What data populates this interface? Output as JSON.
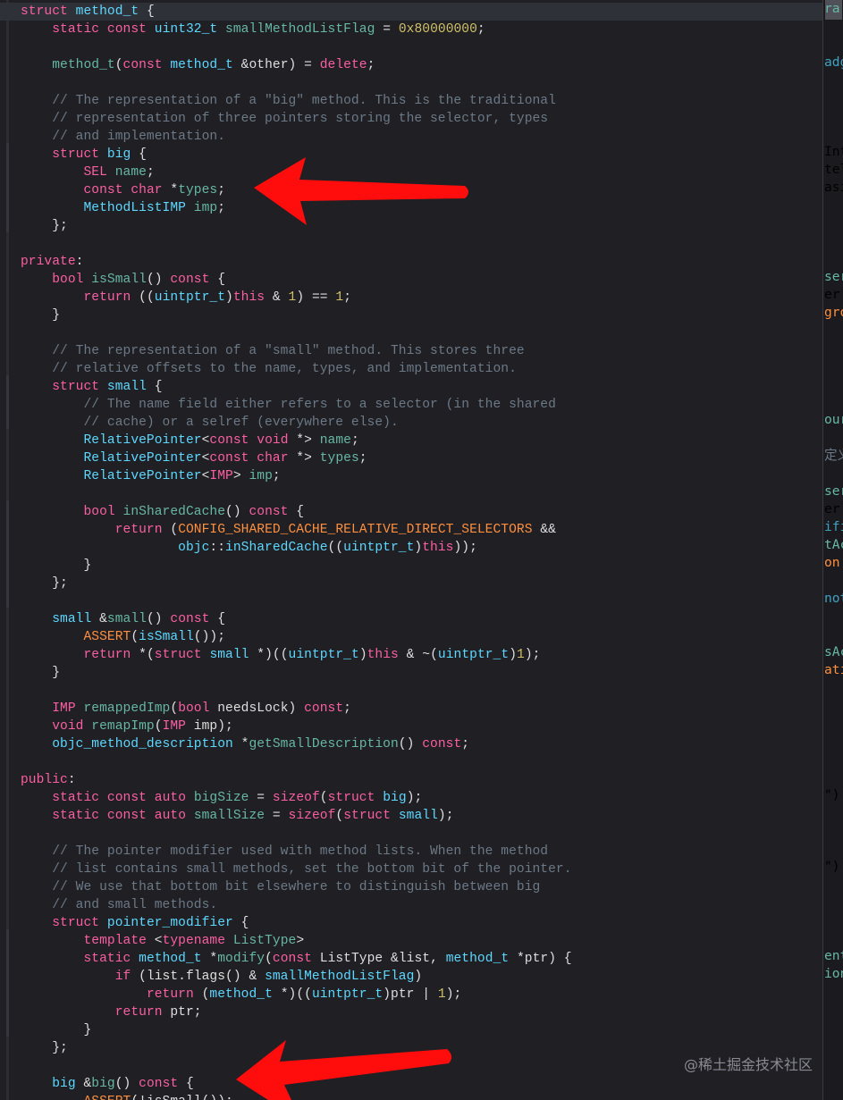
{
  "editor": {
    "lines": [
      [
        {
          "t": "struct",
          "c": "kw"
        },
        {
          "t": " "
        },
        {
          "t": "method_t",
          "c": "ty"
        },
        {
          "t": " {"
        }
      ],
      [
        {
          "t": "    "
        },
        {
          "t": "static",
          "c": "kw"
        },
        {
          "t": " "
        },
        {
          "t": "const",
          "c": "kw"
        },
        {
          "t": " "
        },
        {
          "t": "uint32_t",
          "c": "ty"
        },
        {
          "t": " "
        },
        {
          "t": "smallMethodListFlag",
          "c": "pj"
        },
        {
          "t": " = "
        },
        {
          "t": "0x80000000",
          "c": "nm"
        },
        {
          "t": ";"
        }
      ],
      [],
      [
        {
          "t": "    "
        },
        {
          "t": "method_t",
          "c": "pj"
        },
        {
          "t": "("
        },
        {
          "t": "const",
          "c": "kw"
        },
        {
          "t": " "
        },
        {
          "t": "method_t",
          "c": "ty"
        },
        {
          "t": " &other) = "
        },
        {
          "t": "delete",
          "c": "kw"
        },
        {
          "t": ";"
        }
      ],
      [],
      [
        {
          "t": "    // The representation of a \"big\" method. This is the traditional",
          "c": "cm"
        }
      ],
      [
        {
          "t": "    // representation of three pointers storing the selector, types",
          "c": "cm"
        }
      ],
      [
        {
          "t": "    // and implementation.",
          "c": "cm"
        }
      ],
      [
        {
          "t": "    "
        },
        {
          "t": "struct",
          "c": "kw"
        },
        {
          "t": " "
        },
        {
          "t": "big",
          "c": "ty"
        },
        {
          "t": " {"
        }
      ],
      [
        {
          "t": "        "
        },
        {
          "t": "SEL",
          "c": "kw"
        },
        {
          "t": " "
        },
        {
          "t": "name",
          "c": "pj"
        },
        {
          "t": ";"
        }
      ],
      [
        {
          "t": "        "
        },
        {
          "t": "const",
          "c": "kw"
        },
        {
          "t": " "
        },
        {
          "t": "char",
          "c": "kw"
        },
        {
          "t": " *"
        },
        {
          "t": "types",
          "c": "pj"
        },
        {
          "t": ";"
        }
      ],
      [
        {
          "t": "        "
        },
        {
          "t": "MethodListIMP",
          "c": "ty"
        },
        {
          "t": " "
        },
        {
          "t": "imp",
          "c": "pj"
        },
        {
          "t": ";"
        }
      ],
      [
        {
          "t": "    };"
        }
      ],
      [],
      [
        {
          "t": "private",
          "c": "kw"
        },
        {
          "t": ":"
        }
      ],
      [
        {
          "t": "    "
        },
        {
          "t": "bool",
          "c": "kw"
        },
        {
          "t": " "
        },
        {
          "t": "isSmall",
          "c": "pj"
        },
        {
          "t": "() "
        },
        {
          "t": "const",
          "c": "kw"
        },
        {
          "t": " {"
        }
      ],
      [
        {
          "t": "        "
        },
        {
          "t": "return",
          "c": "kw"
        },
        {
          "t": " (("
        },
        {
          "t": "uintptr_t",
          "c": "ty"
        },
        {
          "t": ")"
        },
        {
          "t": "this",
          "c": "kw"
        },
        {
          "t": " & "
        },
        {
          "t": "1",
          "c": "nm"
        },
        {
          "t": ") == "
        },
        {
          "t": "1",
          "c": "nm"
        },
        {
          "t": ";"
        }
      ],
      [
        {
          "t": "    }"
        }
      ],
      [],
      [
        {
          "t": "    // The representation of a \"small\" method. This stores three",
          "c": "cm"
        }
      ],
      [
        {
          "t": "    // relative offsets to the name, types, and implementation.",
          "c": "cm"
        }
      ],
      [
        {
          "t": "    "
        },
        {
          "t": "struct",
          "c": "kw"
        },
        {
          "t": " "
        },
        {
          "t": "small",
          "c": "ty"
        },
        {
          "t": " {"
        }
      ],
      [
        {
          "t": "        // The name field either refers to a selector (in the shared",
          "c": "cm"
        }
      ],
      [
        {
          "t": "        // cache) or a selref (everywhere else).",
          "c": "cm"
        }
      ],
      [
        {
          "t": "        "
        },
        {
          "t": "RelativePointer",
          "c": "ty"
        },
        {
          "t": "<"
        },
        {
          "t": "const",
          "c": "kw"
        },
        {
          "t": " "
        },
        {
          "t": "void",
          "c": "kw"
        },
        {
          "t": " *> "
        },
        {
          "t": "name",
          "c": "pj"
        },
        {
          "t": ";"
        }
      ],
      [
        {
          "t": "        "
        },
        {
          "t": "RelativePointer",
          "c": "ty"
        },
        {
          "t": "<"
        },
        {
          "t": "const",
          "c": "kw"
        },
        {
          "t": " "
        },
        {
          "t": "char",
          "c": "kw"
        },
        {
          "t": " *> "
        },
        {
          "t": "types",
          "c": "pj"
        },
        {
          "t": ";"
        }
      ],
      [
        {
          "t": "        "
        },
        {
          "t": "RelativePointer",
          "c": "ty"
        },
        {
          "t": "<"
        },
        {
          "t": "IMP",
          "c": "kw"
        },
        {
          "t": "> "
        },
        {
          "t": "imp",
          "c": "pj"
        },
        {
          "t": ";"
        }
      ],
      [],
      [
        {
          "t": "        "
        },
        {
          "t": "bool",
          "c": "kw"
        },
        {
          "t": " "
        },
        {
          "t": "inSharedCache",
          "c": "pj"
        },
        {
          "t": "() "
        },
        {
          "t": "const",
          "c": "kw"
        },
        {
          "t": " {"
        }
      ],
      [
        {
          "t": "            "
        },
        {
          "t": "return",
          "c": "kw"
        },
        {
          "t": " ("
        },
        {
          "t": "CONFIG_SHARED_CACHE_RELATIVE_DIRECT_SELECTORS",
          "c": "pp"
        },
        {
          "t": " &&"
        }
      ],
      [
        {
          "t": "                    "
        },
        {
          "t": "objc",
          "c": "ty"
        },
        {
          "t": "::"
        },
        {
          "t": "inSharedCache",
          "c": "ty"
        },
        {
          "t": "(("
        },
        {
          "t": "uintptr_t",
          "c": "ty"
        },
        {
          "t": ")"
        },
        {
          "t": "this",
          "c": "kw"
        },
        {
          "t": "));"
        }
      ],
      [
        {
          "t": "        }"
        }
      ],
      [
        {
          "t": "    };"
        }
      ],
      [],
      [
        {
          "t": "    "
        },
        {
          "t": "small",
          "c": "ty"
        },
        {
          "t": " &"
        },
        {
          "t": "small",
          "c": "pj"
        },
        {
          "t": "() "
        },
        {
          "t": "const",
          "c": "kw"
        },
        {
          "t": " {"
        }
      ],
      [
        {
          "t": "        "
        },
        {
          "t": "ASSERT",
          "c": "pp"
        },
        {
          "t": "("
        },
        {
          "t": "isSmall",
          "c": "ty"
        },
        {
          "t": "());"
        }
      ],
      [
        {
          "t": "        "
        },
        {
          "t": "return",
          "c": "kw"
        },
        {
          "t": " *("
        },
        {
          "t": "struct",
          "c": "kw"
        },
        {
          "t": " "
        },
        {
          "t": "small",
          "c": "ty"
        },
        {
          "t": " *)(("
        },
        {
          "t": "uintptr_t",
          "c": "ty"
        },
        {
          "t": ")"
        },
        {
          "t": "this",
          "c": "kw"
        },
        {
          "t": " & ~("
        },
        {
          "t": "uintptr_t",
          "c": "ty"
        },
        {
          "t": ")"
        },
        {
          "t": "1",
          "c": "nm"
        },
        {
          "t": ");"
        }
      ],
      [
        {
          "t": "    }"
        }
      ],
      [],
      [
        {
          "t": "    "
        },
        {
          "t": "IMP",
          "c": "kw"
        },
        {
          "t": " "
        },
        {
          "t": "remappedImp",
          "c": "pj"
        },
        {
          "t": "("
        },
        {
          "t": "bool",
          "c": "kw"
        },
        {
          "t": " needsLock) "
        },
        {
          "t": "const",
          "c": "kw"
        },
        {
          "t": ";"
        }
      ],
      [
        {
          "t": "    "
        },
        {
          "t": "void",
          "c": "kw"
        },
        {
          "t": " "
        },
        {
          "t": "remapImp",
          "c": "pj"
        },
        {
          "t": "("
        },
        {
          "t": "IMP",
          "c": "kw"
        },
        {
          "t": " imp);"
        }
      ],
      [
        {
          "t": "    "
        },
        {
          "t": "objc_method_description",
          "c": "ty"
        },
        {
          "t": " *"
        },
        {
          "t": "getSmallDescription",
          "c": "pj"
        },
        {
          "t": "() "
        },
        {
          "t": "const",
          "c": "kw"
        },
        {
          "t": ";"
        }
      ],
      [],
      [
        {
          "t": "public",
          "c": "kw"
        },
        {
          "t": ":"
        }
      ],
      [
        {
          "t": "    "
        },
        {
          "t": "static",
          "c": "kw"
        },
        {
          "t": " "
        },
        {
          "t": "const",
          "c": "kw"
        },
        {
          "t": " "
        },
        {
          "t": "auto",
          "c": "kw"
        },
        {
          "t": " "
        },
        {
          "t": "bigSize",
          "c": "pj"
        },
        {
          "t": " = "
        },
        {
          "t": "sizeof",
          "c": "kw"
        },
        {
          "t": "("
        },
        {
          "t": "struct",
          "c": "kw"
        },
        {
          "t": " "
        },
        {
          "t": "big",
          "c": "ty"
        },
        {
          "t": ");"
        }
      ],
      [
        {
          "t": "    "
        },
        {
          "t": "static",
          "c": "kw"
        },
        {
          "t": " "
        },
        {
          "t": "const",
          "c": "kw"
        },
        {
          "t": " "
        },
        {
          "t": "auto",
          "c": "kw"
        },
        {
          "t": " "
        },
        {
          "t": "smallSize",
          "c": "pj"
        },
        {
          "t": " = "
        },
        {
          "t": "sizeof",
          "c": "kw"
        },
        {
          "t": "("
        },
        {
          "t": "struct",
          "c": "kw"
        },
        {
          "t": " "
        },
        {
          "t": "small",
          "c": "ty"
        },
        {
          "t": ");"
        }
      ],
      [],
      [
        {
          "t": "    // The pointer modifier used with method lists. When the method",
          "c": "cm"
        }
      ],
      [
        {
          "t": "    // list contains small methods, set the bottom bit of the pointer.",
          "c": "cm"
        }
      ],
      [
        {
          "t": "    // We use that bottom bit elsewhere to distinguish between big",
          "c": "cm"
        }
      ],
      [
        {
          "t": "    // and small methods.",
          "c": "cm"
        }
      ],
      [
        {
          "t": "    "
        },
        {
          "t": "struct",
          "c": "kw"
        },
        {
          "t": " "
        },
        {
          "t": "pointer_modifier",
          "c": "ty"
        },
        {
          "t": " {"
        }
      ],
      [
        {
          "t": "        "
        },
        {
          "t": "template",
          "c": "kw"
        },
        {
          "t": " <"
        },
        {
          "t": "typename",
          "c": "kw"
        },
        {
          "t": " "
        },
        {
          "t": "ListType",
          "c": "pj"
        },
        {
          "t": ">"
        }
      ],
      [
        {
          "t": "        "
        },
        {
          "t": "static",
          "c": "kw"
        },
        {
          "t": " "
        },
        {
          "t": "method_t",
          "c": "ty"
        },
        {
          "t": " *"
        },
        {
          "t": "modify",
          "c": "pj"
        },
        {
          "t": "("
        },
        {
          "t": "const",
          "c": "kw"
        },
        {
          "t": " ListType &list, "
        },
        {
          "t": "method_t",
          "c": "ty"
        },
        {
          "t": " *ptr) {"
        }
      ],
      [
        {
          "t": "            "
        },
        {
          "t": "if",
          "c": "kw"
        },
        {
          "t": " (list.flags() & "
        },
        {
          "t": "smallMethodListFlag",
          "c": "ty"
        },
        {
          "t": ")"
        }
      ],
      [
        {
          "t": "                "
        },
        {
          "t": "return",
          "c": "kw"
        },
        {
          "t": " ("
        },
        {
          "t": "method_t",
          "c": "ty"
        },
        {
          "t": " *)(("
        },
        {
          "t": "uintptr_t",
          "c": "ty"
        },
        {
          "t": ")ptr | "
        },
        {
          "t": "1",
          "c": "nm"
        },
        {
          "t": ");"
        }
      ],
      [
        {
          "t": "            "
        },
        {
          "t": "return",
          "c": "kw"
        },
        {
          "t": " ptr;"
        }
      ],
      [
        {
          "t": "        }"
        }
      ],
      [
        {
          "t": "    };"
        }
      ],
      [],
      [
        {
          "t": "    "
        },
        {
          "t": "big",
          "c": "ty"
        },
        {
          "t": " &"
        },
        {
          "t": "big",
          "c": "pj"
        },
        {
          "t": "() "
        },
        {
          "t": "const",
          "c": "kw"
        },
        {
          "t": " {"
        }
      ],
      [
        {
          "t": "        "
        },
        {
          "t": "ASSERT",
          "c": "pp"
        },
        {
          "t": "(!isSmall());"
        }
      ]
    ]
  },
  "peek": {
    "lines": [
      [
        {
          "t": "ra",
          "c": "pj"
        }
      ],
      [],
      [],
      [
        {
          "t": "adg",
          "c": "fn"
        }
      ],
      [],
      [],
      [],
      [],
      [
        {
          "t": "Int"
        }
      ],
      [
        {
          "t": "tel"
        }
      ],
      [
        {
          "t": "asi"
        }
      ],
      [],
      [],
      [],
      [],
      [
        {
          "t": "ser",
          "c": "pj"
        }
      ],
      [
        {
          "t": "er"
        }
      ],
      [
        {
          "t": "gro",
          "c": "pp"
        }
      ],
      [],
      [],
      [],
      [],
      [],
      [
        {
          "t": "our",
          "c": "pj"
        }
      ],
      [],
      [
        {
          "t": "定义",
          "c": "cm"
        }
      ],
      [],
      [
        {
          "t": "ser",
          "c": "pj"
        }
      ],
      [
        {
          "t": "er"
        }
      ],
      [
        {
          "t": "ifi",
          "c": "fn"
        }
      ],
      [
        {
          "t": "tAc",
          "c": "pj"
        }
      ],
      [
        {
          "t": "on",
          "c": "pp"
        }
      ],
      [],
      [
        {
          "t": "not",
          "c": "fn"
        }
      ],
      [],
      [],
      [
        {
          "t": "sAc",
          "c": "pj"
        }
      ],
      [
        {
          "t": "ati",
          "c": "pp"
        }
      ],
      [],
      [],
      [],
      [],
      [],
      [],
      [
        {
          "t": "\")"
        }
      ],
      [],
      [],
      [],
      [
        {
          "t": "\")"
        }
      ],
      [],
      [],
      [],
      [],
      [
        {
          "t": "ent",
          "c": "pj"
        }
      ],
      [
        {
          "t": "ion",
          "c": "pj"
        }
      ],
      [],
      [],
      [],
      [],
      [],
      [],
      []
    ]
  },
  "watermark": "@稀土掘金技术社区",
  "colors": {
    "background": "#1f1f24",
    "keyword": "#fc5fa3",
    "type": "#5dd8ff",
    "project": "#67b7a4",
    "comment": "#6c7986",
    "number": "#d0bf69",
    "preprocessor": "#fd8f3f",
    "annotation_arrow": "#ff0d0d"
  },
  "annotations": [
    "red-arrow-pointing-to-types-line",
    "red-arrow-pointing-to-big-accessor"
  ]
}
